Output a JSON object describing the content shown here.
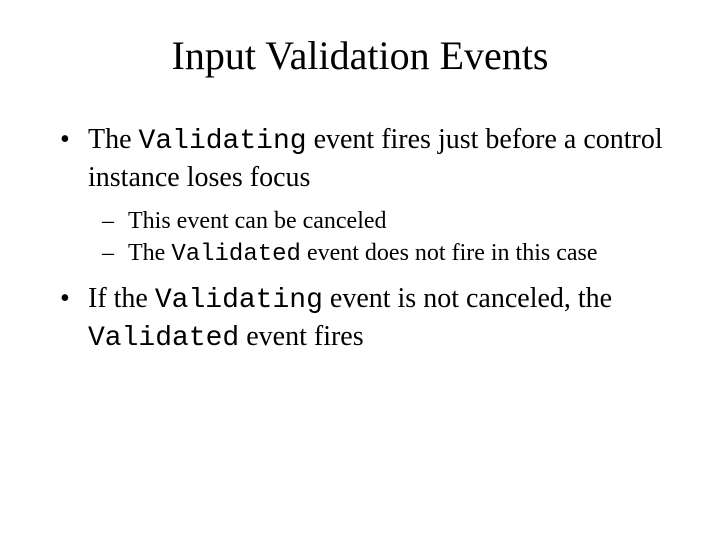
{
  "title": "Input Validation Events",
  "bullets": [
    {
      "pre1": "The ",
      "code1": "Validating",
      "post1": " event fires just before a control instance loses focus",
      "sub": [
        {
          "text": "This event can be canceled"
        },
        {
          "pre1": "The ",
          "code1": "Validated",
          "post1": " event does not fire in this case"
        }
      ]
    },
    {
      "pre1": "If the ",
      "code1": "Validating",
      "mid1": " event is not canceled, the ",
      "code2": "Validated",
      "post1": " event fires"
    }
  ]
}
